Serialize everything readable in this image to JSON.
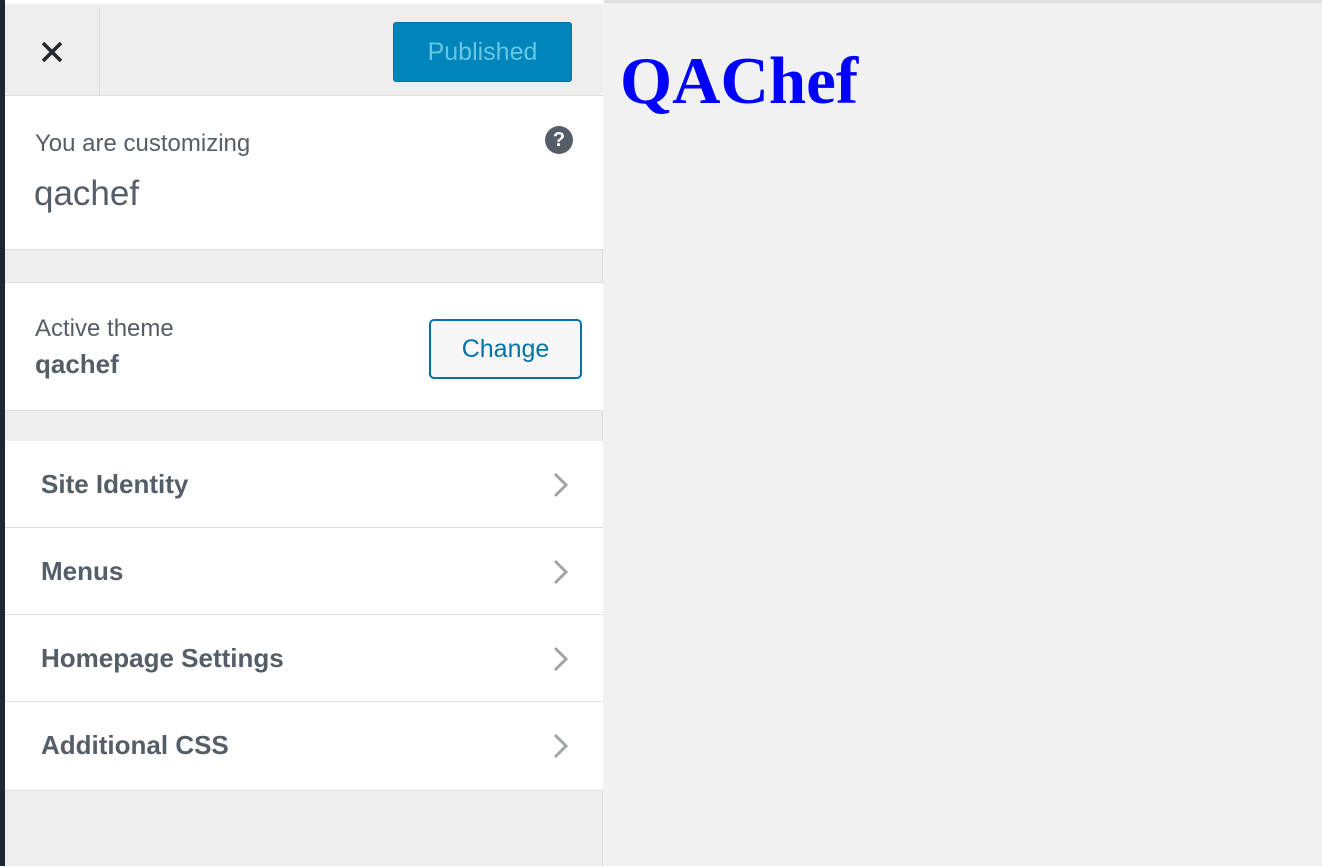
{
  "header": {
    "close_icon": "close-icon",
    "publish_label": "Published"
  },
  "info": {
    "customizing_label": "You are customizing",
    "site_name": "qachef",
    "help_icon_text": "?"
  },
  "theme": {
    "label": "Active theme",
    "name": "qachef",
    "change_label": "Change"
  },
  "sections": [
    {
      "label": "Site Identity",
      "icon": "chevron-right-icon"
    },
    {
      "label": "Menus",
      "icon": "chevron-right-icon"
    },
    {
      "label": "Homepage Settings",
      "icon": "chevron-right-icon"
    },
    {
      "label": "Additional CSS",
      "icon": "chevron-right-icon"
    }
  ],
  "preview": {
    "site_title": "QAChef"
  },
  "colors": {
    "accent": "#0085ba",
    "link": "#0073aa",
    "text": "#555d66",
    "site_title": "#0000ff"
  }
}
